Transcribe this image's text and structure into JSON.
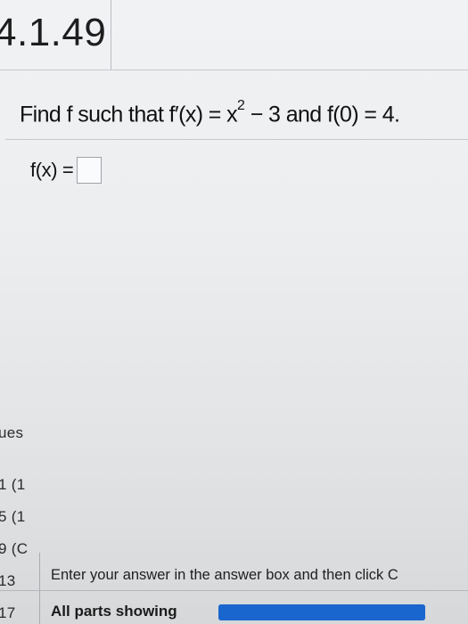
{
  "header": {
    "problem_number": "4.1.49"
  },
  "question": {
    "prefix": "Find f such that f′(x) = x",
    "exponent": "2",
    "suffix": " − 3 and f(0) = 4."
  },
  "answer": {
    "label": "f(x) =",
    "value": ""
  },
  "sidebar_fragments": [
    "ues",
    "1 (1",
    "5 (1",
    "9 (C",
    "13",
    "17"
  ],
  "footer": {
    "instruction": "Enter your answer in the answer box and then click C",
    "parts_label": "All parts showing",
    "progress": 1.0
  },
  "colors": {
    "progress": "#1f6fd6"
  }
}
